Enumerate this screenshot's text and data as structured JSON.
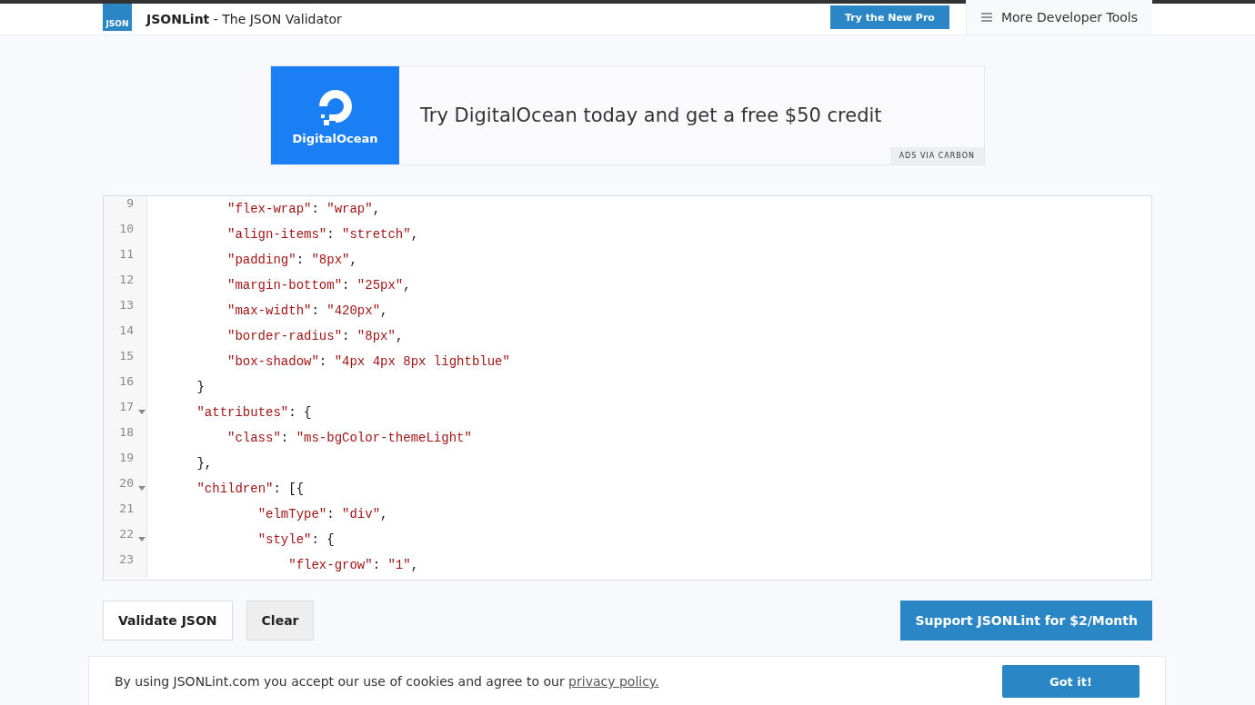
{
  "header": {
    "logo": "JSON",
    "brand": "JSONLint",
    "tagline": " - The JSON Validator",
    "pro_button": "Try the New Pro",
    "tools_menu": "More Developer Tools"
  },
  "ad": {
    "logo_text": "DigitalOcean",
    "headline": "Try DigitalOcean today and get a free $50 credit",
    "badge": "ADS VIA CARBON"
  },
  "editor": {
    "lines": [
      {
        "number": "9",
        "text": "          \"flex-wrap\": \"wrap\","
      },
      {
        "number": "10",
        "text": "          \"align-items\": \"stretch\","
      },
      {
        "number": "11",
        "text": "          \"padding\": \"8px\","
      },
      {
        "number": "12",
        "text": "          \"margin-bottom\": \"25px\","
      },
      {
        "number": "13",
        "text": "          \"max-width\": \"420px\","
      },
      {
        "number": "14",
        "text": "          \"border-radius\": \"8px\","
      },
      {
        "number": "15",
        "text": "          \"box-shadow\": \"4px 4px 8px lightblue\""
      },
      {
        "number": "16",
        "text": "      }"
      },
      {
        "number": "17",
        "text": "      \"attributes\": {",
        "expanded": true
      },
      {
        "number": "18",
        "text": "          \"class\": \"ms-bgColor-themeLight\""
      },
      {
        "number": "19",
        "text": "      },"
      },
      {
        "number": "20",
        "text": "      \"children\": [{",
        "expanded": true
      },
      {
        "number": "21",
        "text": "              \"elmType\": \"div\","
      },
      {
        "number": "22",
        "text": "              \"style\": {",
        "expanded": true
      },
      {
        "number": "23",
        "text": "                  \"flex-grow\": \"1\","
      }
    ]
  },
  "actions": {
    "validate": "Validate JSON",
    "clear": "Clear",
    "support": "Support JSONLint for $2/Month"
  },
  "cookie_banner": {
    "text": "By using JSONLint.com you accept our use of cookies and agree to our ",
    "link": "privacy policy.",
    "button": "Got it!"
  }
}
